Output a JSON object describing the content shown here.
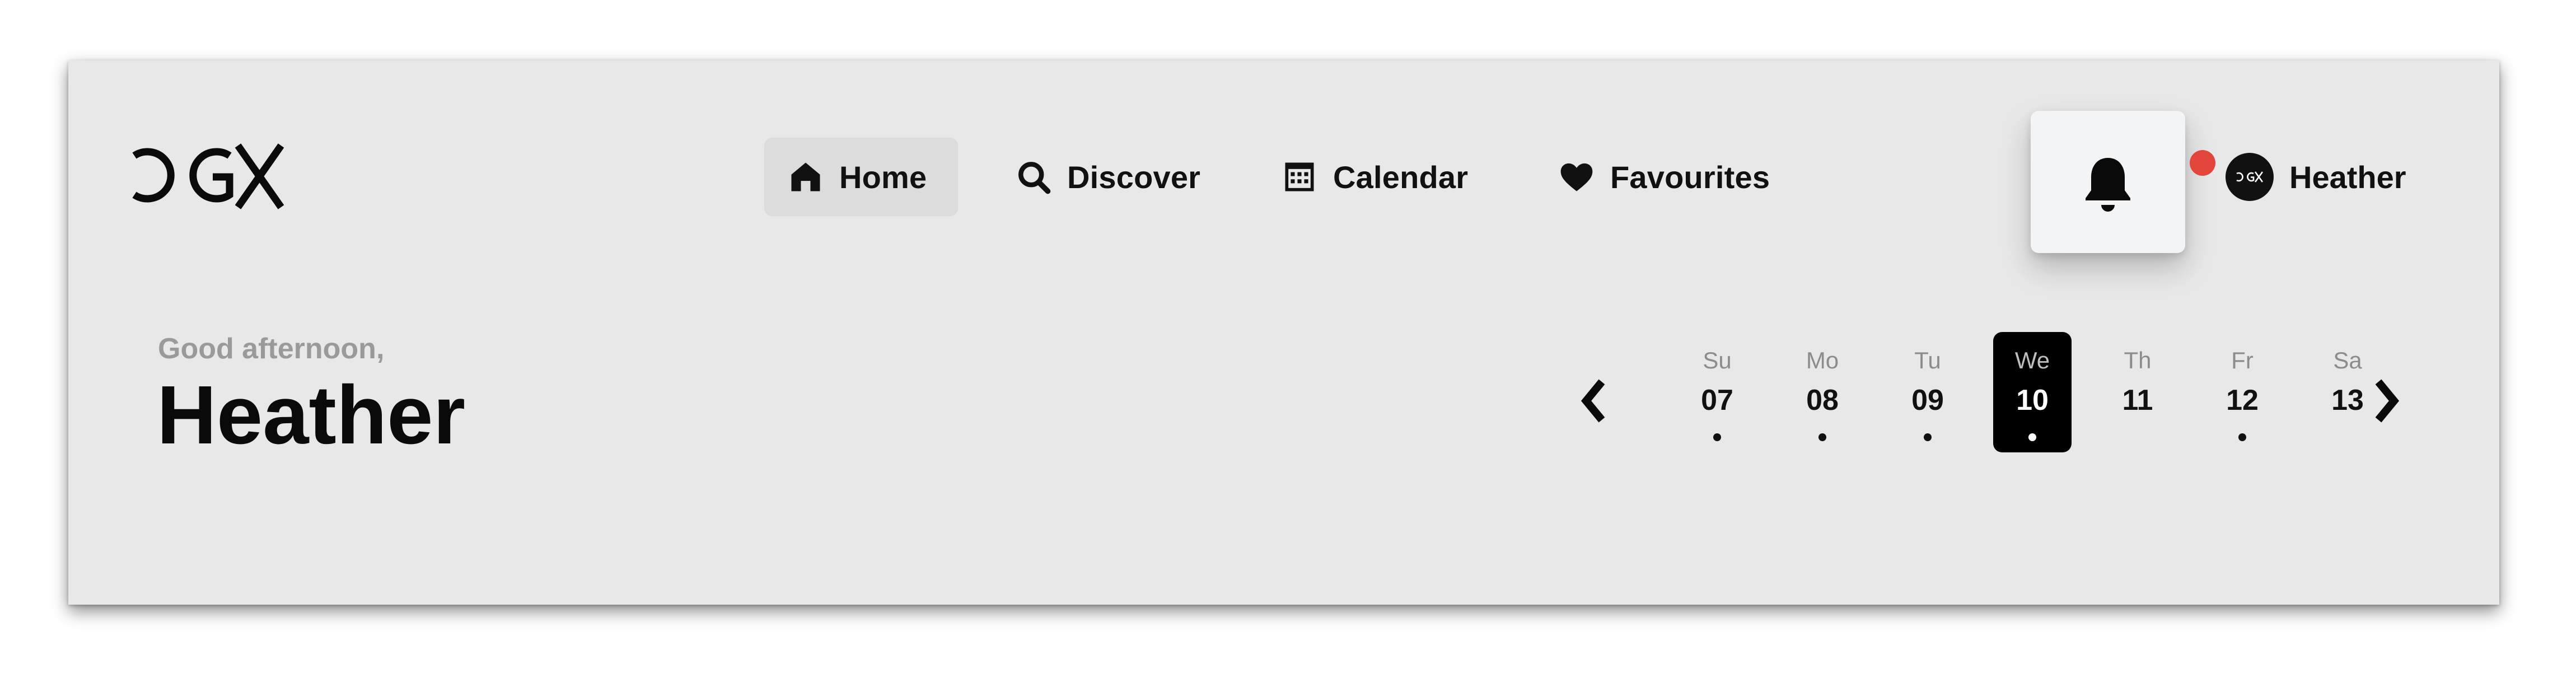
{
  "brand": {
    "logo_text": "CGX",
    "logo_icon": "cgx-logo"
  },
  "nav": {
    "items": [
      {
        "label": "Home",
        "icon": "home-icon",
        "active": true
      },
      {
        "label": "Discover",
        "icon": "search-icon",
        "active": false
      },
      {
        "label": "Calendar",
        "icon": "calendar-icon",
        "active": false
      },
      {
        "label": "Favourites",
        "icon": "heart-icon",
        "active": false
      }
    ]
  },
  "notifications": {
    "icon": "bell-icon",
    "has_unread": true,
    "badge_color": "#e2463a"
  },
  "user": {
    "name": "Heather",
    "avatar_text": "CGX"
  },
  "greeting": {
    "line1": "Good afternoon,",
    "name": "Heather"
  },
  "calendar_strip": {
    "prev_icon": "chevron-left-icon",
    "next_icon": "chevron-right-icon",
    "days": [
      {
        "name": "Su",
        "date": "07",
        "has_event": true,
        "selected": false
      },
      {
        "name": "Mo",
        "date": "08",
        "has_event": true,
        "selected": false
      },
      {
        "name": "Tu",
        "date": "09",
        "has_event": true,
        "selected": false
      },
      {
        "name": "We",
        "date": "10",
        "has_event": true,
        "selected": true
      },
      {
        "name": "Th",
        "date": "11",
        "has_event": false,
        "selected": false
      },
      {
        "name": "Fr",
        "date": "12",
        "has_event": true,
        "selected": false
      },
      {
        "name": "Sa",
        "date": "13",
        "has_event": false,
        "selected": false
      }
    ]
  },
  "colors": {
    "background": "#e8e8e8",
    "accent": "#000000",
    "muted_text": "#9a9a9a",
    "notification": "#e2463a"
  }
}
